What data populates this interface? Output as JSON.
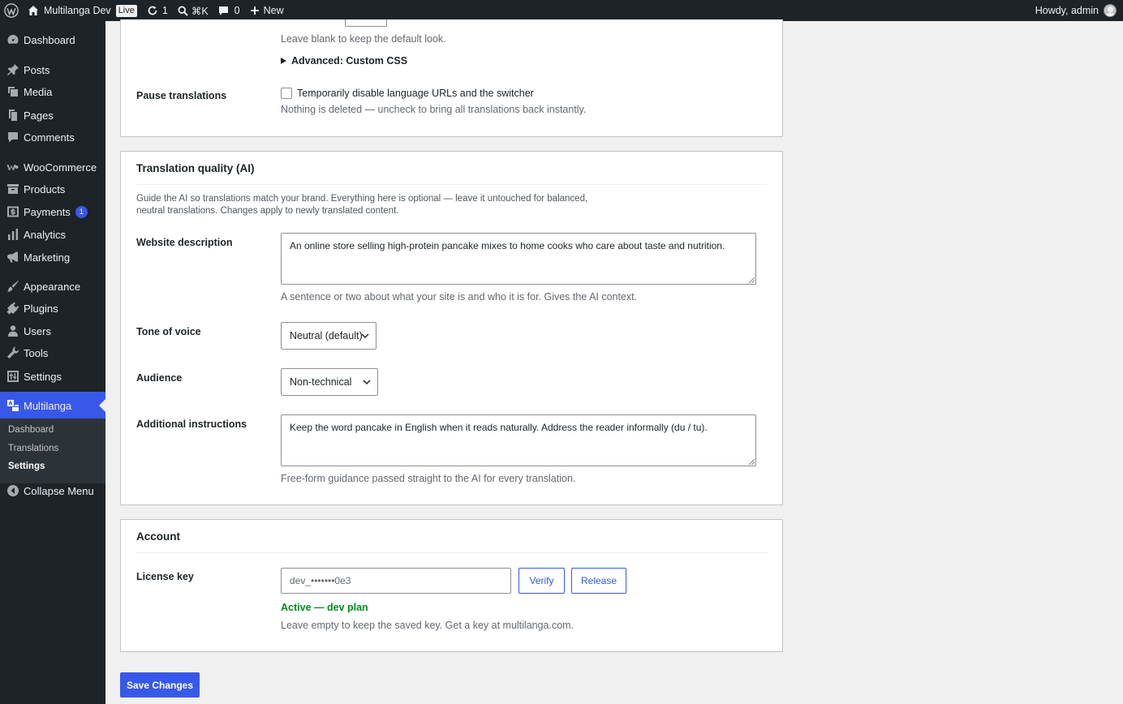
{
  "adminbar": {
    "site_name": "Multilanga Dev",
    "live_label": "Live",
    "updates_count": "1",
    "search_shortcut": "⌘K",
    "comments_count": "0",
    "new_label": "New",
    "greeting": "Howdy, admin"
  },
  "sidebar": {
    "items": [
      {
        "label": "Dashboard",
        "icon": "dashboard-icon"
      },
      {
        "label": "Posts",
        "icon": "pin-icon"
      },
      {
        "label": "Media",
        "icon": "media-icon"
      },
      {
        "label": "Pages",
        "icon": "pages-icon"
      },
      {
        "label": "Comments",
        "icon": "comment-icon"
      },
      {
        "label": "WooCommerce",
        "icon": "woocommerce-icon"
      },
      {
        "label": "Products",
        "icon": "archive-icon"
      },
      {
        "label": "Payments",
        "icon": "dollar-icon",
        "badge": "1"
      },
      {
        "label": "Analytics",
        "icon": "bar-chart-icon"
      },
      {
        "label": "Marketing",
        "icon": "megaphone-icon"
      },
      {
        "label": "Appearance",
        "icon": "brush-icon"
      },
      {
        "label": "Plugins",
        "icon": "plug-icon"
      },
      {
        "label": "Users",
        "icon": "user-icon"
      },
      {
        "label": "Tools",
        "icon": "wrench-icon"
      },
      {
        "label": "Settings",
        "icon": "settings-icon"
      },
      {
        "label": "Multilanga",
        "icon": "translate-icon",
        "current": true
      }
    ],
    "submenu": [
      "Dashboard",
      "Translations",
      "Settings"
    ],
    "collapse_label": "Collapse Menu"
  },
  "top_card": {
    "default_look_help": "Leave blank to keep the default look.",
    "advanced_css_label": "Advanced: Custom CSS",
    "pause_label": "Pause translations",
    "pause_checkbox_label": "Temporarily disable language URLs and the switcher",
    "pause_checked": false,
    "pause_help": "Nothing is deleted — uncheck to bring all translations back instantly."
  },
  "ai_card": {
    "title": "Translation quality (AI)",
    "intro_line1": "Guide the AI so translations match your brand. Everything here is optional — leave it untouched for balanced,",
    "intro_line2": "neutral translations. Changes apply to newly translated content.",
    "website_description_label": "Website description",
    "website_description_value": "An online store selling high-protein pancake mixes to home cooks who care about taste and nutrition.",
    "website_description_help": "A sentence or two about what your site is and who it is for. Gives the AI context.",
    "tone_label": "Tone of voice",
    "tone_value": "Neutral (default)",
    "audience_label": "Audience",
    "audience_value": "Non-technical",
    "instructions_label": "Additional instructions",
    "instructions_value": "Keep the word pancake in English when it reads naturally. Address the reader informally (du / tu).",
    "instructions_help": "Free-form guidance passed straight to the AI for every translation."
  },
  "account_card": {
    "title": "Account",
    "license_label": "License key",
    "license_placeholder": "dev_•••••••0e3",
    "verify_label": "Verify",
    "release_label": "Release",
    "status_text": "Active — dev plan",
    "status_color": "#008a20",
    "help": "Leave empty to keep the saved key. Get a key at multilanga.com."
  },
  "save_label": "Save Changes",
  "colors": {
    "accent": "#3858e9",
    "adminbar": "#1d2327"
  }
}
